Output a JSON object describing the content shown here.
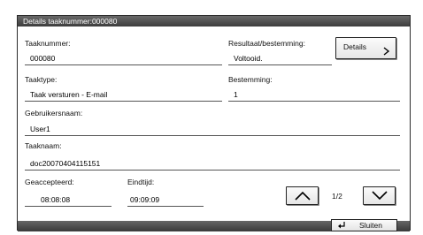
{
  "window": {
    "title": "Details taaknummer:000080"
  },
  "fields": {
    "job_number": {
      "label": "Taaknummer:",
      "value": "000080"
    },
    "result": {
      "label": "Resultaat/bestemming:",
      "value": "Voltooid."
    },
    "job_type": {
      "label": "Taaktype:",
      "value": "Taak versturen - E-mail"
    },
    "destination": {
      "label": "Bestemming:",
      "value": "1"
    },
    "user_name": {
      "label": "Gebruikersnaam:",
      "value": "User1"
    },
    "job_name": {
      "label": "Taaknaam:",
      "value": "doc20070404115151"
    },
    "accepted": {
      "label": "Geaccepteerd:",
      "value": "08:08:08"
    },
    "end_time": {
      "label": "Eindtijd:",
      "value": "09:09:09"
    }
  },
  "buttons": {
    "details": "Details",
    "close": "Sluiten"
  },
  "pagination": {
    "indicator": "1/2"
  },
  "icons": {
    "details": "chevron-right-icon",
    "page_up": "chevron-up-icon",
    "page_down": "chevron-down-icon",
    "close": "return-arrow-icon"
  }
}
